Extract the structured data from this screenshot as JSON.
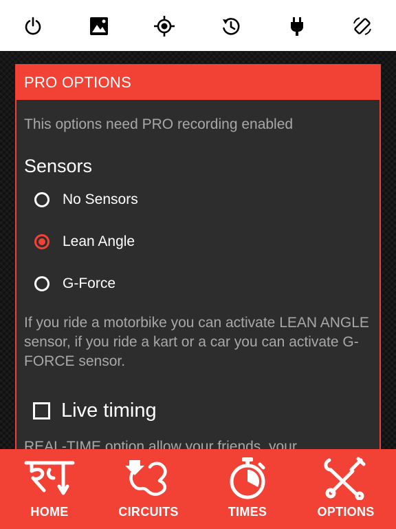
{
  "toolbar": {
    "icons": [
      "power-icon",
      "image-icon",
      "gps-target-icon",
      "history-refresh-icon",
      "plug-icon",
      "screen-rotation-icon"
    ]
  },
  "panel": {
    "title": "PRO OPTIONS",
    "intro": "This options need PRO recording enabled",
    "sensors": {
      "title": "Sensors",
      "options": [
        {
          "label": "No Sensors",
          "selected": false
        },
        {
          "label": "Lean Angle",
          "selected": true
        },
        {
          "label": "G-Force",
          "selected": false
        }
      ],
      "description": "If you ride a motorbike you can activate LEAN ANGLE sensor, if you ride a kart or a car you can activate G-FORCE sensor."
    },
    "live_timing": {
      "label": "Live timing",
      "checked": false,
      "description_partial": "REAL-TIME option allow your friends, your"
    }
  },
  "tabbar": {
    "tabs": [
      {
        "label": "HOME",
        "icon": "rt-logo-icon"
      },
      {
        "label": "CIRCUITS",
        "icon": "circuit-map-icon"
      },
      {
        "label": "TIMES",
        "icon": "stopwatch-icon"
      },
      {
        "label": "OPTIONS",
        "icon": "tools-icon"
      }
    ]
  },
  "colors": {
    "accent": "#f24236",
    "panel_bg": "#2d2d2d",
    "muted_text": "#a8a8a8"
  }
}
